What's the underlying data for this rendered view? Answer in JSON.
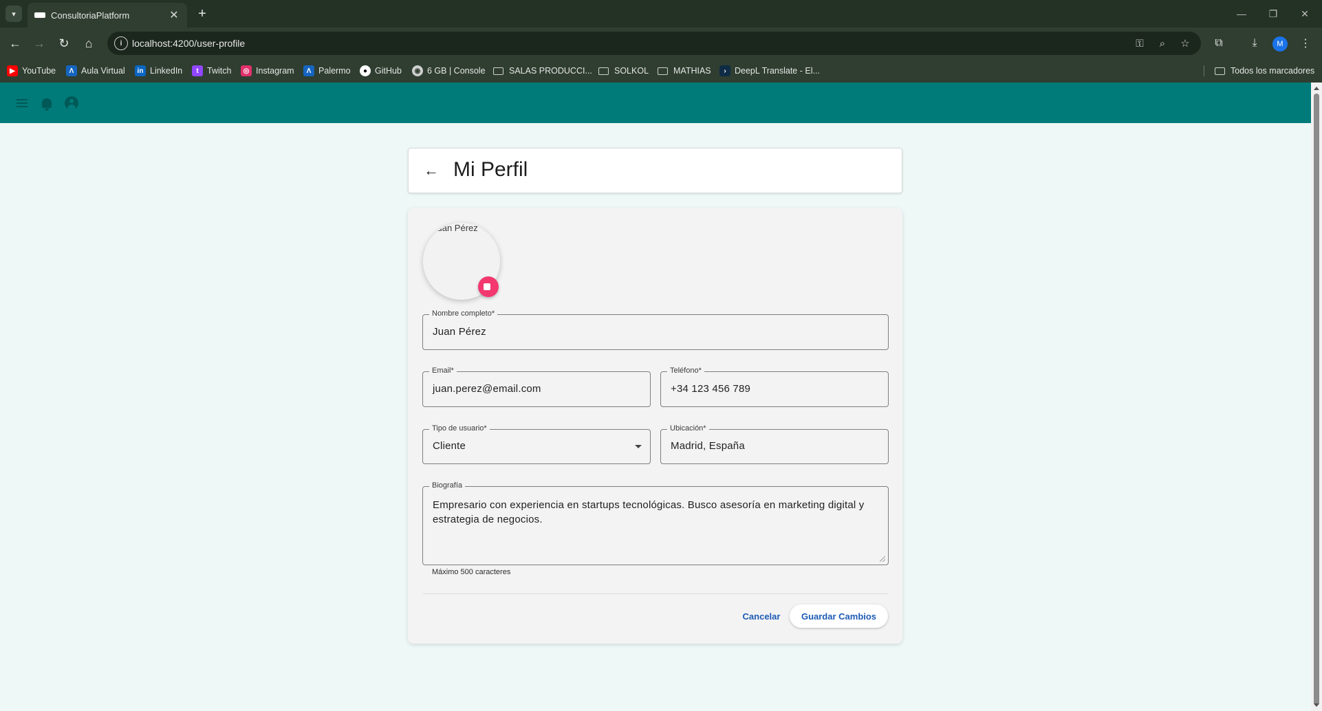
{
  "browser": {
    "tab_title": "ConsultoriaPlatform",
    "url": "localhost:4200/user-profile",
    "profile_initial": "M",
    "bookmarks": [
      {
        "label": "YouTube",
        "icon": "youtube-icon",
        "color": "#ff0000"
      },
      {
        "label": "Aula Virtual",
        "icon": "aula-virtual-icon",
        "color": "#1565c0"
      },
      {
        "label": "LinkedIn",
        "icon": "linkedin-icon",
        "color": "#0a66c2"
      },
      {
        "label": "Twitch",
        "icon": "twitch-icon",
        "color": "#9146ff"
      },
      {
        "label": "Instagram",
        "icon": "instagram-icon",
        "color": "#e1306c"
      },
      {
        "label": "Palermo",
        "icon": "palermo-icon",
        "color": "#1565c0"
      },
      {
        "label": "GitHub",
        "icon": "github-icon",
        "color": "#ffffff"
      },
      {
        "label": "6 GB | Console",
        "icon": "globe-icon",
        "color": "#cfcfcf"
      },
      {
        "label": "SALAS PRODUCCI...",
        "icon": "folder-icon"
      },
      {
        "label": "SOLKOL",
        "icon": "folder-icon"
      },
      {
        "label": "MATHIAS",
        "icon": "folder-icon"
      },
      {
        "label": "DeepL Translate - El...",
        "icon": "deepl-icon",
        "color": "#0f2b46"
      }
    ],
    "all_bookmarks": "Todos los marcadores"
  },
  "app": {
    "header_color": "#007b79"
  },
  "profile": {
    "page_title": "Mi Perfil",
    "avatar_alt": "Juan Pérez",
    "fields": {
      "full_name": {
        "label": "Nombre completo*",
        "value": "Juan Pérez"
      },
      "email": {
        "label": "Email*",
        "value": "juan.perez@email.com"
      },
      "phone": {
        "label": "Teléfono*",
        "value": "+34 123 456 789"
      },
      "user_type": {
        "label": "Tipo de usuario*",
        "value": "Cliente"
      },
      "location": {
        "label": "Ubicación*",
        "value": "Madrid, España"
      },
      "bio": {
        "label": "Biografía",
        "value": "Empresario con experiencia en startups tecnológicas. Busco asesoría en marketing digital y estrategia de negocios."
      }
    },
    "bio_hint": "Máximo 500 caracteres",
    "cancel_label": "Cancelar",
    "save_label": "Guardar Cambios",
    "accent_color": "#1d5bb5",
    "edit_badge_color": "#f2386f"
  }
}
